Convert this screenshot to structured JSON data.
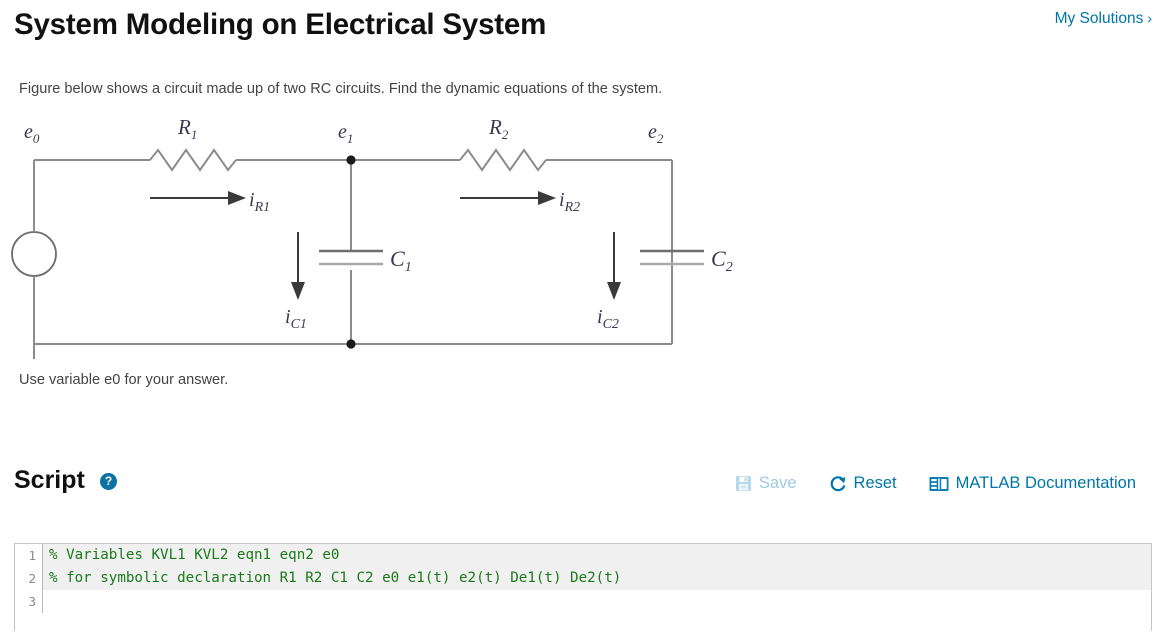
{
  "header": {
    "title": "System Modeling on Electrical System",
    "my_solutions_label": "My Solutions",
    "my_solutions_chevron": "›"
  },
  "problem": {
    "statement": "Figure below shows a circuit made up of two RC circuits. Find the dynamic equations of the system.",
    "answer_note": "Use variable e0 for your answer."
  },
  "figure": {
    "labels": {
      "source_node": "e",
      "source_node_sub": "0",
      "r1": "R",
      "r1_sub": "1",
      "node1": "e",
      "node1_sub": "1",
      "r2": "R",
      "r2_sub": "2",
      "node2": "e",
      "node2_sub": "2",
      "i_r1": "i",
      "i_r1_sub": "R1",
      "i_r2": "i",
      "i_r2_sub": "R2",
      "i_c1": "i",
      "i_c1_sub": "C1",
      "i_c2": "i",
      "i_c2_sub": "C2",
      "c1": "C",
      "c1_sub": "1",
      "c2": "C",
      "c2_sub": "2"
    },
    "wire_color": "#8c8c8c",
    "label_color": "#3a3a52"
  },
  "script": {
    "title": "Script",
    "help_glyph": "?",
    "toolbar": {
      "save_label": "Save",
      "reset_label": "Reset",
      "docs_label": "MATLAB Documentation",
      "save_color": "#9ecbdf",
      "link_color": "#0076a8"
    }
  },
  "editor": {
    "lines": [
      {
        "number": "1",
        "text": "% Variables KVL1 KVL2 eqn1 eqn2 e0",
        "highlight": true
      },
      {
        "number": "2",
        "text": "% for symbolic declaration R1 R2 C1 C2 e0 e1(t) e2(t) De1(t) De2(t)",
        "highlight": true
      },
      {
        "number": "3",
        "text": "",
        "highlight": false
      }
    ],
    "comment_color": "#1a7a1a"
  }
}
